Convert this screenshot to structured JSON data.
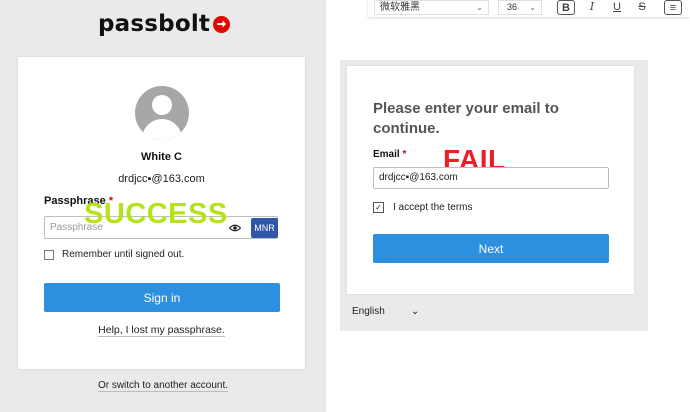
{
  "left": {
    "logo_text": "passbolt",
    "user_name": "White C",
    "user_email": "drdjcc▪@163.com",
    "passphrase_label": "Passphrase",
    "required_mark": "*",
    "passphrase_placeholder": "Passphrase",
    "mnr_badge": "MNR",
    "overlay_text": "SUCCESS",
    "remember_label": "Remember until signed out.",
    "signin_label": "Sign in",
    "lost_passphrase": "Help, I lost my passphrase.",
    "switch_account": "Or switch to another account."
  },
  "right": {
    "title": "Please enter your email to continue.",
    "email_label": "Email",
    "required_mark": "*",
    "overlay_text": "FAIL",
    "email_value": "drdjcc▪@163.com",
    "terms_label": "I accept the terms",
    "terms_checked": "✓",
    "next_label": "Next",
    "language": "English",
    "language_chevron": "⌄"
  },
  "toolbar": {
    "font_name": "微软雅黑",
    "font_size": "36",
    "chevron": "⌄",
    "bold": "B",
    "italic": "I",
    "underline": "U",
    "strike": "S",
    "align": "≡"
  },
  "colors": {
    "accent_blue": "#2d8fe0",
    "success_green": "#b4e31c",
    "fail_red": "#ee1c25",
    "brand_red": "#e10600",
    "mnr_blue": "#2f56a8"
  }
}
